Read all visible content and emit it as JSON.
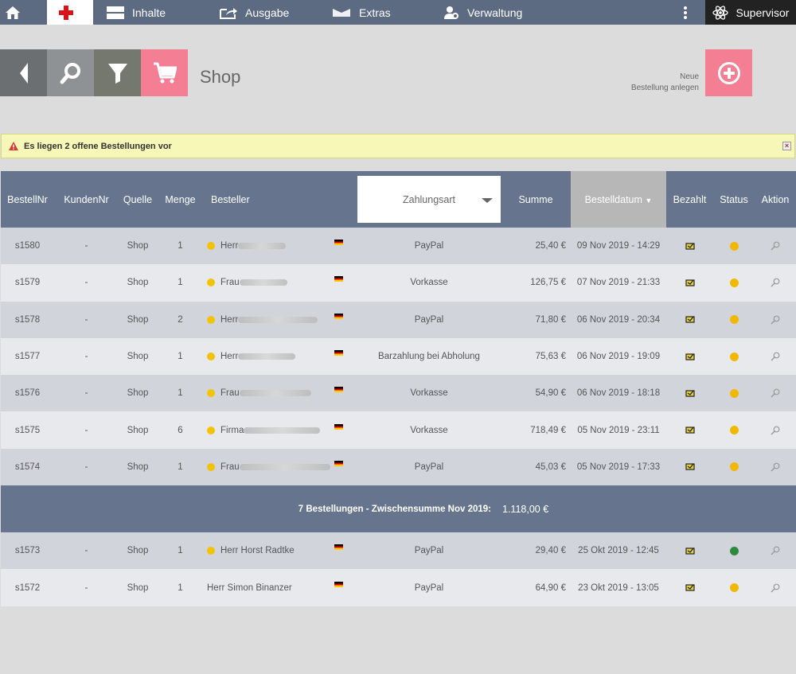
{
  "nav": {
    "items": [
      "Inhalte",
      "Ausgabe",
      "Extras",
      "Verwaltung"
    ],
    "user": "Supervisor"
  },
  "page": {
    "title": "Shop",
    "new_label_line1": "Neue",
    "new_label_line2": "Bestellung anlegen"
  },
  "alert": {
    "text": "Es liegen 2 offene Bestellungen vor"
  },
  "table": {
    "headers": {
      "nr": "BestellNr",
      "kunde": "KundenNr",
      "quelle": "Quelle",
      "menge": "Menge",
      "besteller": "Besteller",
      "zahlungsart": "Zahlungsart",
      "summe": "Summe",
      "datum": "Bestelldatum",
      "bezahlt": "Bezahlt",
      "status": "Status",
      "aktion": "Aktion"
    },
    "rows_nov": [
      {
        "nr": "s1580",
        "kunde": "-",
        "quelle": "Shop",
        "menge": "1",
        "name": "Herr",
        "zahlung": "PayPal",
        "summe": "25,40 €",
        "datum": "09 Nov 2019 - 14:29",
        "status": "pending"
      },
      {
        "nr": "s1579",
        "kunde": "-",
        "quelle": "Shop",
        "menge": "1",
        "name": "Frau",
        "zahlung": "Vorkasse",
        "summe": "126,75 €",
        "datum": "07 Nov 2019 - 21:33",
        "status": "pending"
      },
      {
        "nr": "s1578",
        "kunde": "-",
        "quelle": "Shop",
        "menge": "2",
        "name": "Herr",
        "zahlung": "PayPal",
        "summe": "71,80 €",
        "datum": "06 Nov 2019 - 20:34",
        "status": "pending"
      },
      {
        "nr": "s1577",
        "kunde": "-",
        "quelle": "Shop",
        "menge": "1",
        "name": "Herr",
        "zahlung": "Barzahlung bei Abholung",
        "summe": "75,63 €",
        "datum": "06 Nov 2019 - 19:09",
        "status": "pending"
      },
      {
        "nr": "s1576",
        "kunde": "-",
        "quelle": "Shop",
        "menge": "1",
        "name": "Frau",
        "zahlung": "Vorkasse",
        "summe": "54,90 €",
        "datum": "06 Nov 2019 - 18:18",
        "status": "pending"
      },
      {
        "nr": "s1575",
        "kunde": "-",
        "quelle": "Shop",
        "menge": "6",
        "name": "Firma",
        "zahlung": "Vorkasse",
        "summe": "718,49 €",
        "datum": "05 Nov 2019 - 23:11",
        "status": "pending"
      },
      {
        "nr": "s1574",
        "kunde": "-",
        "quelle": "Shop",
        "menge": "1",
        "name": "Frau",
        "zahlung": "PayPal",
        "summe": "45,03 €",
        "datum": "05 Nov 2019 - 17:33",
        "status": "pending"
      }
    ],
    "subtotal_label": "7 Bestellungen - Zwischensumme Nov 2019:",
    "subtotal_value": "1.118,00 €",
    "rows_okt": [
      {
        "nr": "s1573",
        "kunde": "-",
        "quelle": "Shop",
        "menge": "1",
        "name": "Herr Horst Radtke",
        "zahlung": "PayPal",
        "summe": "29,40 €",
        "datum": "25 Okt 2019 - 12:45",
        "status": "ok"
      },
      {
        "nr": "s1572",
        "kunde": "-",
        "quelle": "Shop",
        "menge": "1",
        "name": "Herr Simon Binanzer",
        "zahlung": "PayPal",
        "summe": "64,90 €",
        "datum": "23 Okt 2019 - 13:05",
        "status": "pending"
      }
    ]
  }
}
